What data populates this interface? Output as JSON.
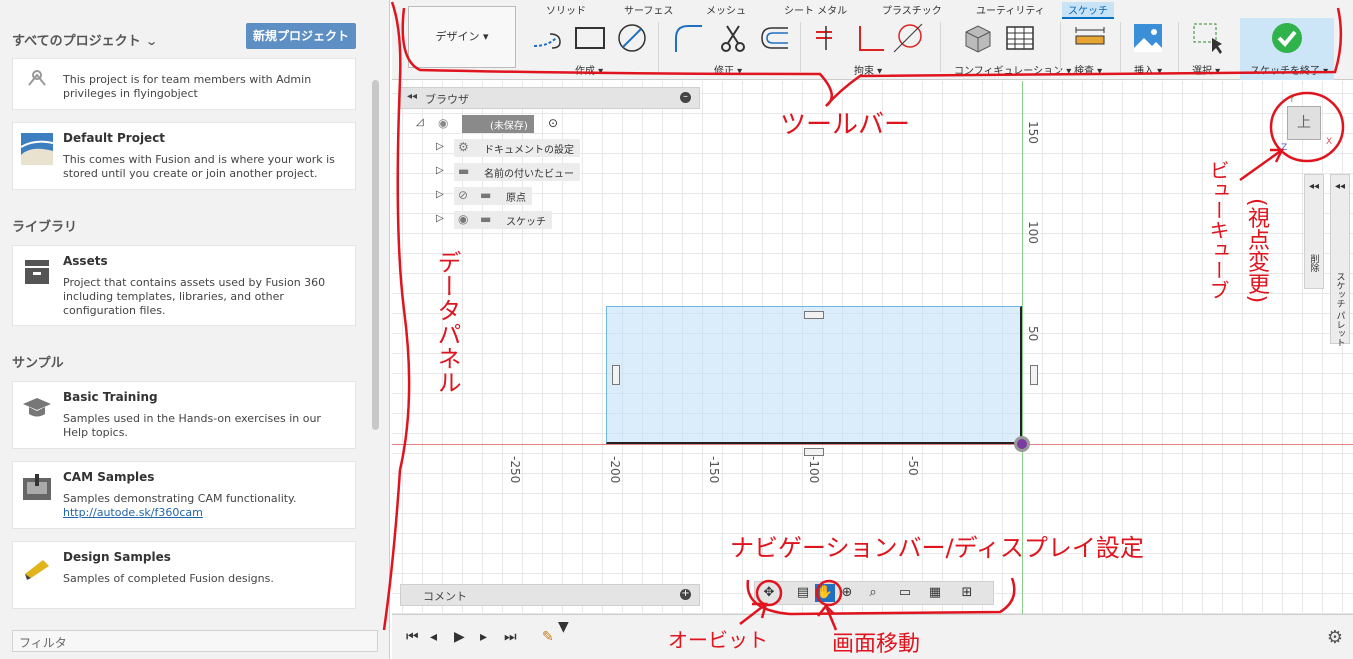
{
  "left_panel": {
    "header": "すべてのプロジェクト",
    "new_project_button": "新規プロジェクト",
    "projects": [
      {
        "title": "",
        "desc": "This project is for team members with Admin privileges in flyingobject"
      },
      {
        "title": "Default Project",
        "desc": "This comes with Fusion and is where your work is stored until you create or join another project."
      }
    ],
    "library_label": "ライブラリ",
    "library": [
      {
        "title": "Assets",
        "desc": "Project that contains assets used by Fusion 360 including templates, libraries, and other configuration files."
      }
    ],
    "samples_label": "サンプル",
    "samples": [
      {
        "title": "Basic Training",
        "desc": "Samples used in the Hands-on exercises in our Help topics.",
        "link": ""
      },
      {
        "title": "CAM Samples",
        "desc": "Samples demonstrating CAM functionality.",
        "link": "http://autode.sk/f360cam"
      },
      {
        "title": "Design Samples",
        "desc": "Samples of completed Fusion designs.",
        "link": ""
      }
    ],
    "filter": "フィルタ"
  },
  "toolbar": {
    "design_button": "デザイン ▾",
    "tabs": [
      "ソリッド",
      "サーフェス",
      "メッシュ",
      "シート メタル",
      "プラスチック",
      "ユーティリティ",
      "スケッチ"
    ],
    "active_tab": "スケッチ",
    "groups": [
      "作成 ▾",
      "修正 ▾",
      "拘束 ▾",
      "コンフィギュレーション ▾",
      "検査 ▾",
      "挿入 ▾",
      "選択 ▾",
      "スケッチを終了 ▾"
    ]
  },
  "browser": {
    "title": "ブラウザ",
    "root": "(未保存)",
    "nodes": [
      "ドキュメントの設定",
      "名前の付いたビュー",
      "原点",
      "スケッチ"
    ]
  },
  "canvas": {
    "x_ticks": [
      "-250",
      "-200",
      "-150",
      "-100",
      "-50"
    ],
    "y_ticks": [
      "150",
      "100",
      "50"
    ],
    "viewcube": "上",
    "view_axis_y": "Y",
    "view_axis_x": "X",
    "view_axis_z": "Z",
    "side_panes": [
      "削除",
      "スケッチ パレット"
    ],
    "comment": "コメント"
  },
  "annotations": {
    "toolbar": "ツールバー",
    "data_panel": "データパネル",
    "viewcube": "ビューキューブ",
    "viewcube_note": "(視点変更)",
    "navbar": "ナビゲーションバー/ディスプレイ設定",
    "orbit": "オービット",
    "pan": "画面移動",
    "color": "#e0141e"
  }
}
